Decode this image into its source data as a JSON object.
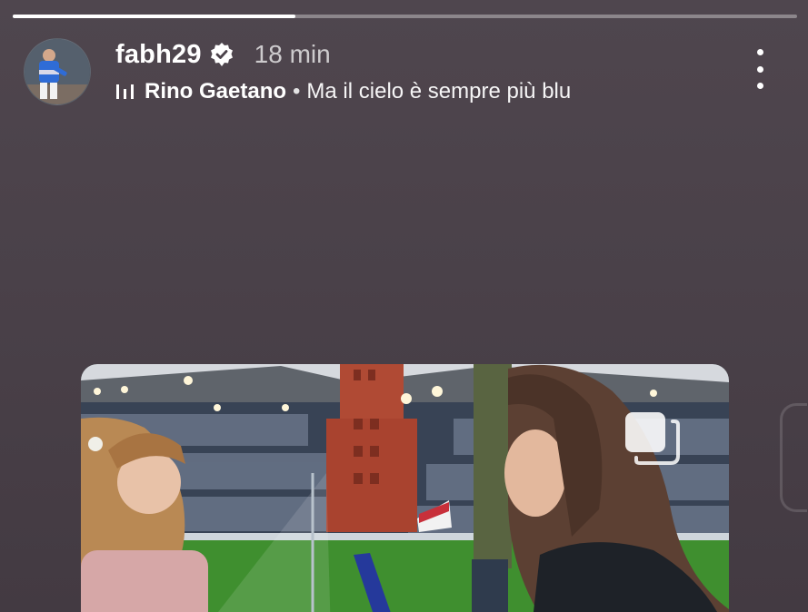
{
  "story": {
    "progress_fraction": 0.36,
    "username": "fabh29",
    "verified": true,
    "timestamp": "18 min",
    "music": {
      "icon": "music-bars-icon",
      "artist": "Rino Gaetano",
      "separator": "•",
      "track": "Ma il cielo è sempre più blu"
    },
    "menu_icon": "more-vertical-icon",
    "photo_icon": "share-stack-icon"
  },
  "colors": {
    "background": "#4a4149",
    "text": "#ffffff",
    "muted_text": "#bdb5bc",
    "pitch_green": "#3f8f2f",
    "stadium_red": "#b04a34"
  }
}
